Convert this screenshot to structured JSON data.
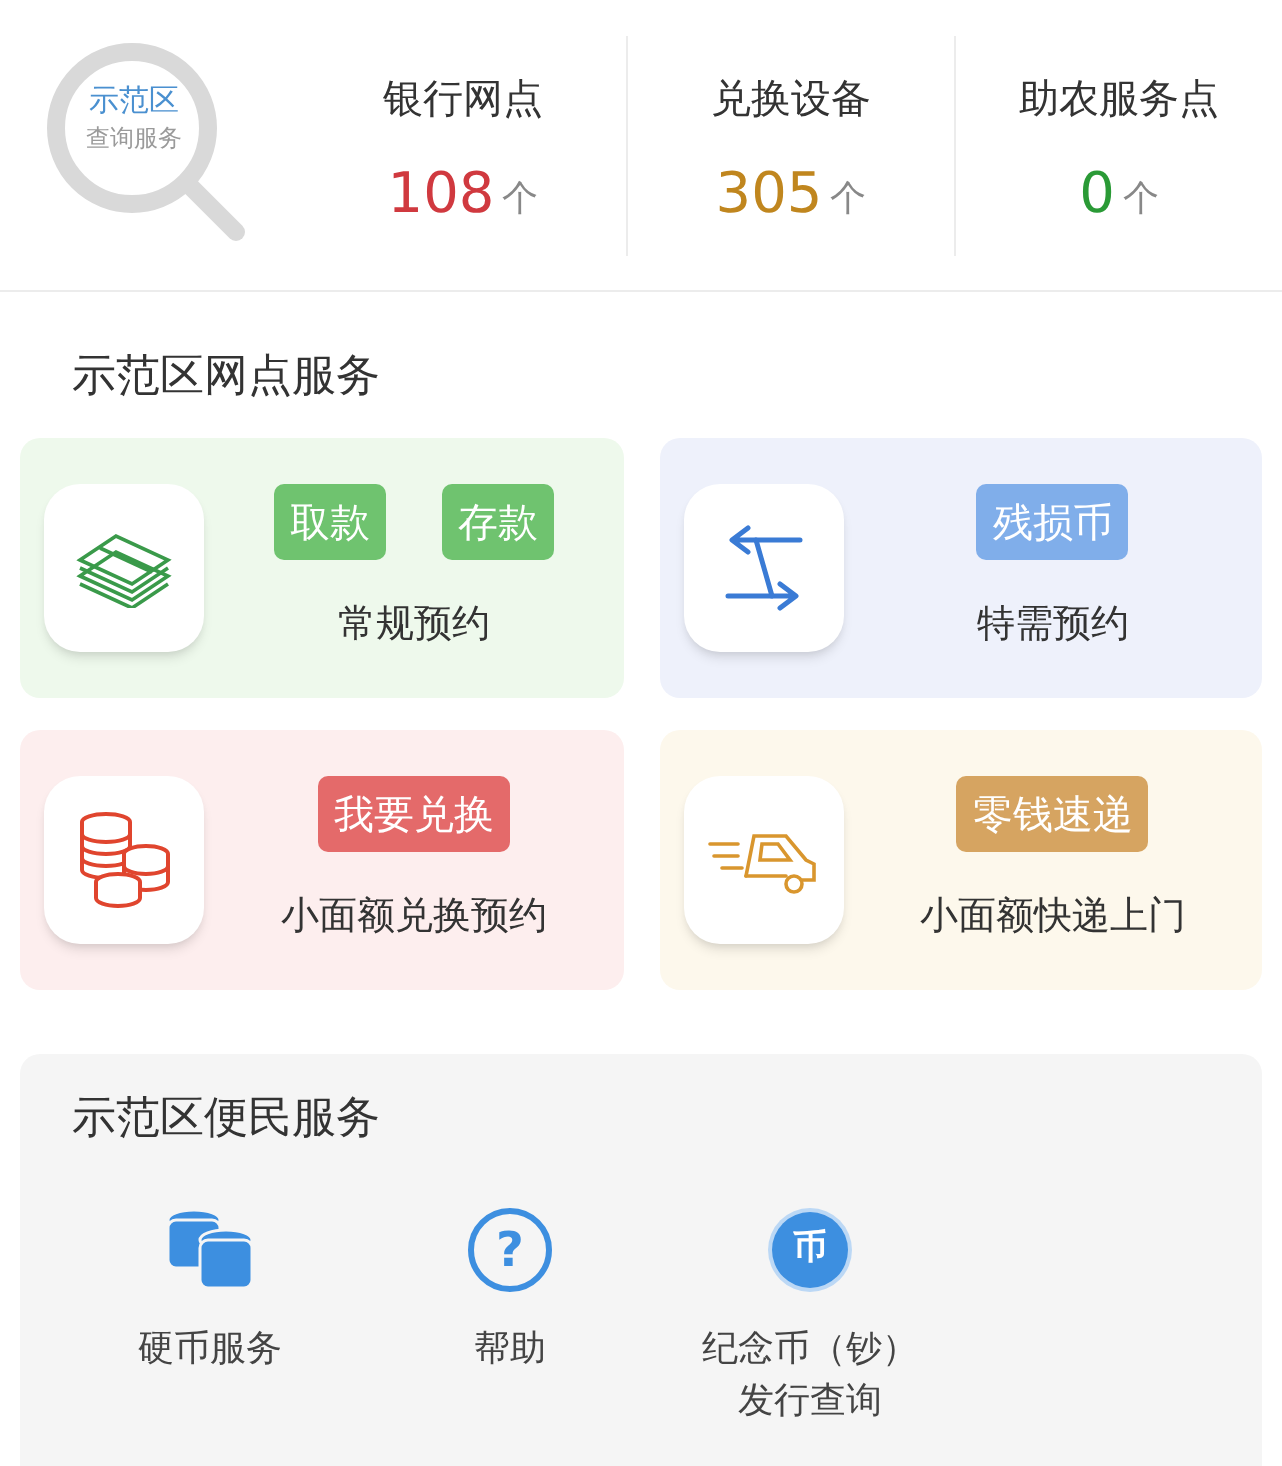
{
  "search_badge": {
    "line_1": "示范区",
    "line_2": "查询服务"
  },
  "stats": [
    {
      "label": "银行网点",
      "value": "108",
      "unit": "个",
      "color": "#d0393f"
    },
    {
      "label": "兑换设备",
      "value": "305",
      "unit": "个",
      "color": "#c0861e"
    },
    {
      "label": "助农服务点",
      "value": "0",
      "unit": "个",
      "color": "#2a9a36"
    }
  ],
  "outlet_services": {
    "title": "示范区网点服务",
    "cards": [
      {
        "title": "常规预约",
        "color": "#6fc36f",
        "tags": [
          "取款",
          "存款"
        ]
      },
      {
        "title": "特需预约",
        "color": "#80aeea",
        "tags": [
          "残损币"
        ]
      },
      {
        "title": "小面额兑换预约",
        "color": "#e46a6a",
        "tags": [
          "我要兑换"
        ]
      },
      {
        "title": "小面额快递上门",
        "color": "#d6a461",
        "tags": [
          "零钱速递"
        ]
      }
    ]
  },
  "convenience_services": {
    "title": "示范区便民服务",
    "items": [
      {
        "lines": [
          "硬币服务"
        ]
      },
      {
        "lines": [
          "帮助"
        ],
        "icon_text": "?"
      },
      {
        "lines": [
          "纪念币（钞）",
          "发行查询"
        ],
        "icon_text": "币"
      }
    ]
  }
}
